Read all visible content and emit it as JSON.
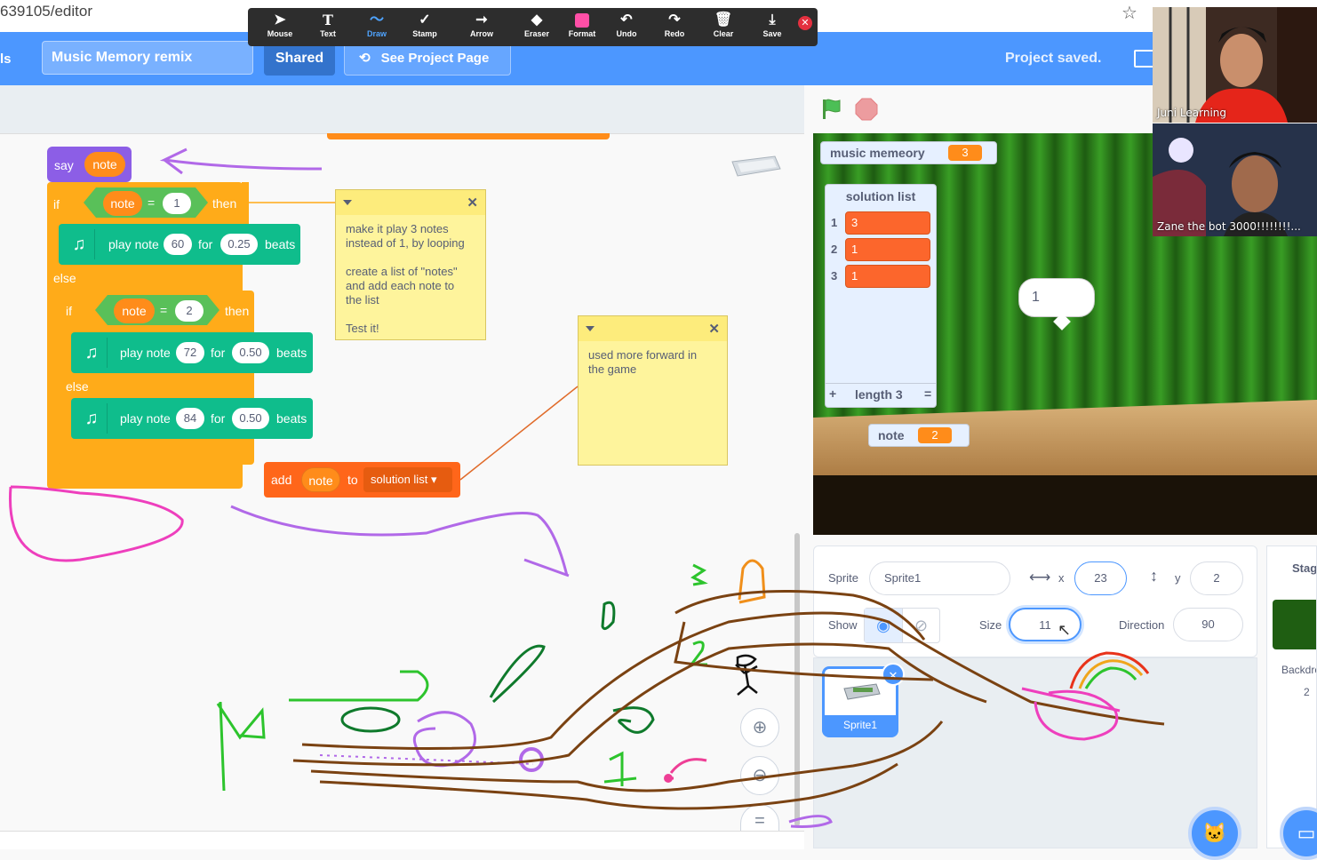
{
  "browser": {
    "url_fragment": "639105/editor"
  },
  "menu": {
    "left_cut_label": "ls",
    "project_title": "Music Memory remix",
    "shared_label": "Shared",
    "see_project_label": "See Project Page",
    "status": "Project saved."
  },
  "annotation_toolbar": {
    "tools": [
      {
        "label": "Mouse",
        "icon": "cursor-icon"
      },
      {
        "label": "Text",
        "icon": "text-icon"
      },
      {
        "label": "Draw",
        "icon": "draw-icon"
      },
      {
        "label": "Stamp",
        "icon": "stamp-icon"
      },
      {
        "label": "Arrow",
        "icon": "arrow-icon"
      },
      {
        "label": "Eraser",
        "icon": "eraser-icon"
      },
      {
        "label": "Format",
        "icon": "format-icon"
      },
      {
        "label": "Undo",
        "icon": "undo-icon"
      },
      {
        "label": "Redo",
        "icon": "redo-icon"
      },
      {
        "label": "Clear",
        "icon": "trash-icon"
      },
      {
        "label": "Save",
        "icon": "save-icon"
      }
    ],
    "active_tool": "Draw",
    "format_color": "#ff4fa7"
  },
  "code": {
    "say_block": {
      "verb": "say",
      "arg": "note"
    },
    "if1": {
      "if": "if",
      "var": "note",
      "op": "=",
      "value": "1",
      "then": "then"
    },
    "play1": {
      "prefix": "play note",
      "note": "60",
      "for": "for",
      "beats_value": "0.25",
      "beats": "beats"
    },
    "else1": "else",
    "if2": {
      "if": "if",
      "var": "note",
      "op": "=",
      "value": "2",
      "then": "then"
    },
    "play2": {
      "prefix": "play note",
      "note": "72",
      "for": "for",
      "beats_value": "0.50",
      "beats": "beats"
    },
    "else2": "else",
    "play3": {
      "prefix": "play note",
      "note": "84",
      "for": "for",
      "beats_value": "0.50",
      "beats": "beats"
    },
    "add_block": {
      "verb": "add",
      "var": "note",
      "to": "to",
      "list": "solution list"
    }
  },
  "comments": [
    {
      "text": "make it play 3 notes\ninstead of 1, by looping\n\ncreate a list of \"notes\"\nand add each note to\nthe list\n\nTest it!"
    },
    {
      "text": "used more forward in\nthe game"
    }
  ],
  "stage": {
    "var_monitor": {
      "label": "music memeory",
      "value": "3"
    },
    "list_monitor": {
      "title": "solution list",
      "items": [
        "3",
        "1",
        "1"
      ],
      "indexes": [
        "1",
        "2",
        "3"
      ],
      "add": "+",
      "length_label": "length 3",
      "resize": "="
    },
    "note_monitor": {
      "label": "note",
      "value": "2"
    },
    "speech_bubble": "1"
  },
  "sprite_info": {
    "sprite_label": "Sprite",
    "sprite_name": "Sprite1",
    "x_label": "x",
    "x_value": "23",
    "y_label": "y",
    "y_value": "2",
    "show_label": "Show",
    "size_label": "Size",
    "size_value": "11",
    "direction_label": "Direction",
    "direction_value": "90"
  },
  "sprite_list": {
    "tiles": [
      {
        "name": "Sprite1"
      }
    ]
  },
  "stage_panel": {
    "title": "Stag",
    "backdrops_label": "Backdro",
    "backdrops_count": "2"
  },
  "webcams": [
    {
      "name": "Juni Learning"
    },
    {
      "name": "Zane the bot 3000!!!!!!!!..."
    }
  ],
  "colors": {
    "menu_blue": "#4c97ff",
    "events": "#8c5ee6",
    "control": "#ffab19",
    "operators": "#59c059",
    "music": "#0fbd8c",
    "variables": "#ff8c1a",
    "lists": "#ff661a"
  }
}
